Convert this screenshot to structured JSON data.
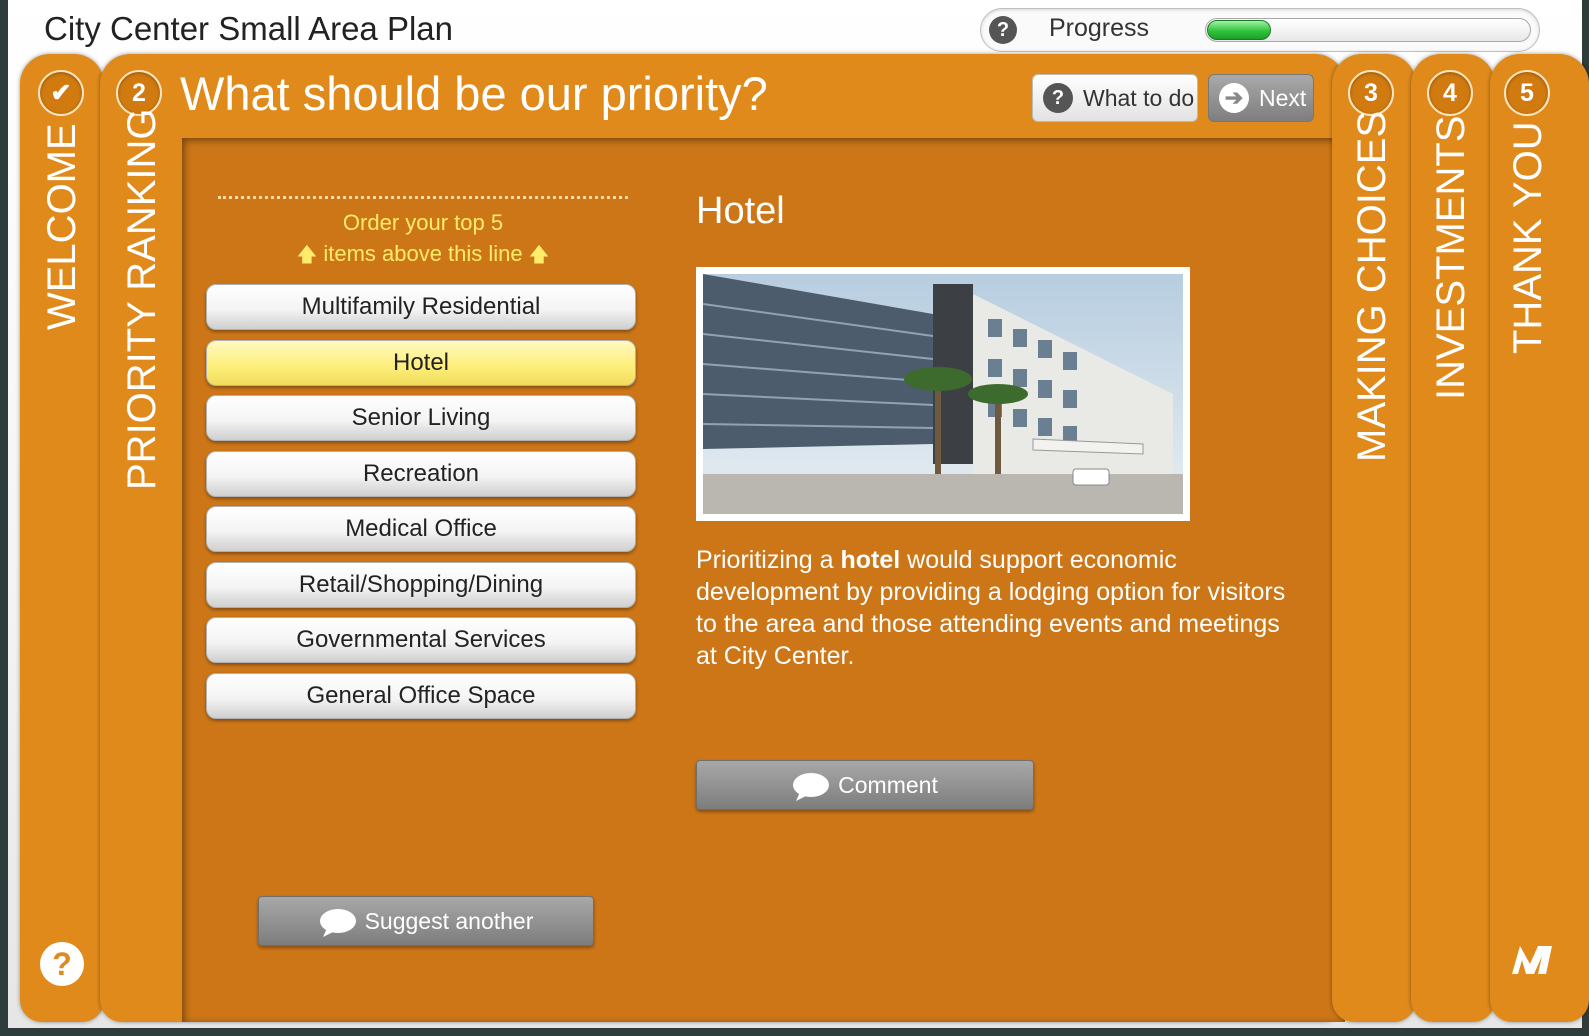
{
  "app": {
    "title": "City Center Small Area Plan"
  },
  "progress": {
    "label": "Progress",
    "fraction": 0.2
  },
  "steps": [
    {
      "number": "✔",
      "label": "WELCOME"
    },
    {
      "number": "2",
      "label": "PRIORITY RANKING"
    },
    {
      "number": "3",
      "label": "MAKING CHOICES"
    },
    {
      "number": "4",
      "label": "INVESTMENTS"
    },
    {
      "number": "5",
      "label": "THANK YOU"
    }
  ],
  "current": {
    "title": "What should be our priority?",
    "what_to_do": "What to do",
    "next": "Next"
  },
  "ranking": {
    "instruction_line1": "Order your top 5",
    "instruction_line2": "items above this line",
    "items": [
      "Multifamily Residential",
      "Hotel",
      "Senior Living",
      "Recreation",
      "Medical Office",
      "Retail/Shopping/Dining",
      "Governmental Services",
      "General Office Space"
    ],
    "selected_index": 1,
    "suggest": "Suggest another"
  },
  "detail": {
    "title": "Hotel",
    "desc_before": "Prioritizing a ",
    "desc_bold": "hotel",
    "desc_after": " would support economic development by providing a lodging option for visitors to the area and those attending events and meetings at City Center.",
    "comment": "Comment"
  },
  "icons": {
    "help": "question-icon",
    "next": "arrow-right-icon",
    "comment": "speech-bubble-icon",
    "logo": "mysidewalk-logo"
  },
  "colors": {
    "panel": "#e08a1c",
    "content": "#cc7618",
    "selected": "#fdee78",
    "instruction": "#ffec6a"
  }
}
